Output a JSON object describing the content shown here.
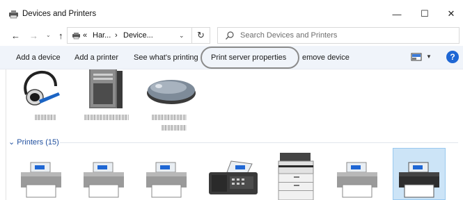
{
  "window": {
    "title": "Devices and Printers",
    "controls": {
      "minimize": "—",
      "maximize": "☐",
      "close": "✕"
    }
  },
  "navigation": {
    "back": "←",
    "forward": "→",
    "recent": "⌄",
    "up": "↑",
    "breadcrumb": [
      "«",
      "Har...",
      "›",
      "Device..."
    ],
    "refresh": "↻",
    "search_placeholder": "Search Devices and Printers"
  },
  "commandbar": {
    "items": [
      "Add a device",
      "Add a printer",
      "See what's printing",
      "Print server properties",
      "emove device"
    ],
    "help": "?",
    "highlighted_item": "Print server properties"
  },
  "devices": {
    "icons": [
      "headset-icon",
      "computer-tower-icon",
      "mouse-icon"
    ],
    "labels_obscured": true
  },
  "printers_group": {
    "label": "Printers (15)",
    "expanded": true
  },
  "printers": {
    "icons": [
      "printer-icon",
      "printer-icon",
      "printer-icon",
      "fax-icon",
      "multifunction-printer-icon",
      "printer-icon",
      "printer-icon"
    ],
    "selected_index": 6
  },
  "colors": {
    "command_bar_bg": "#f0f4fa",
    "group_header": "#1e4e9e",
    "selection_bg": "#cce4f7",
    "selection_border": "#99c9ef",
    "help_blue": "#1f67d4"
  }
}
